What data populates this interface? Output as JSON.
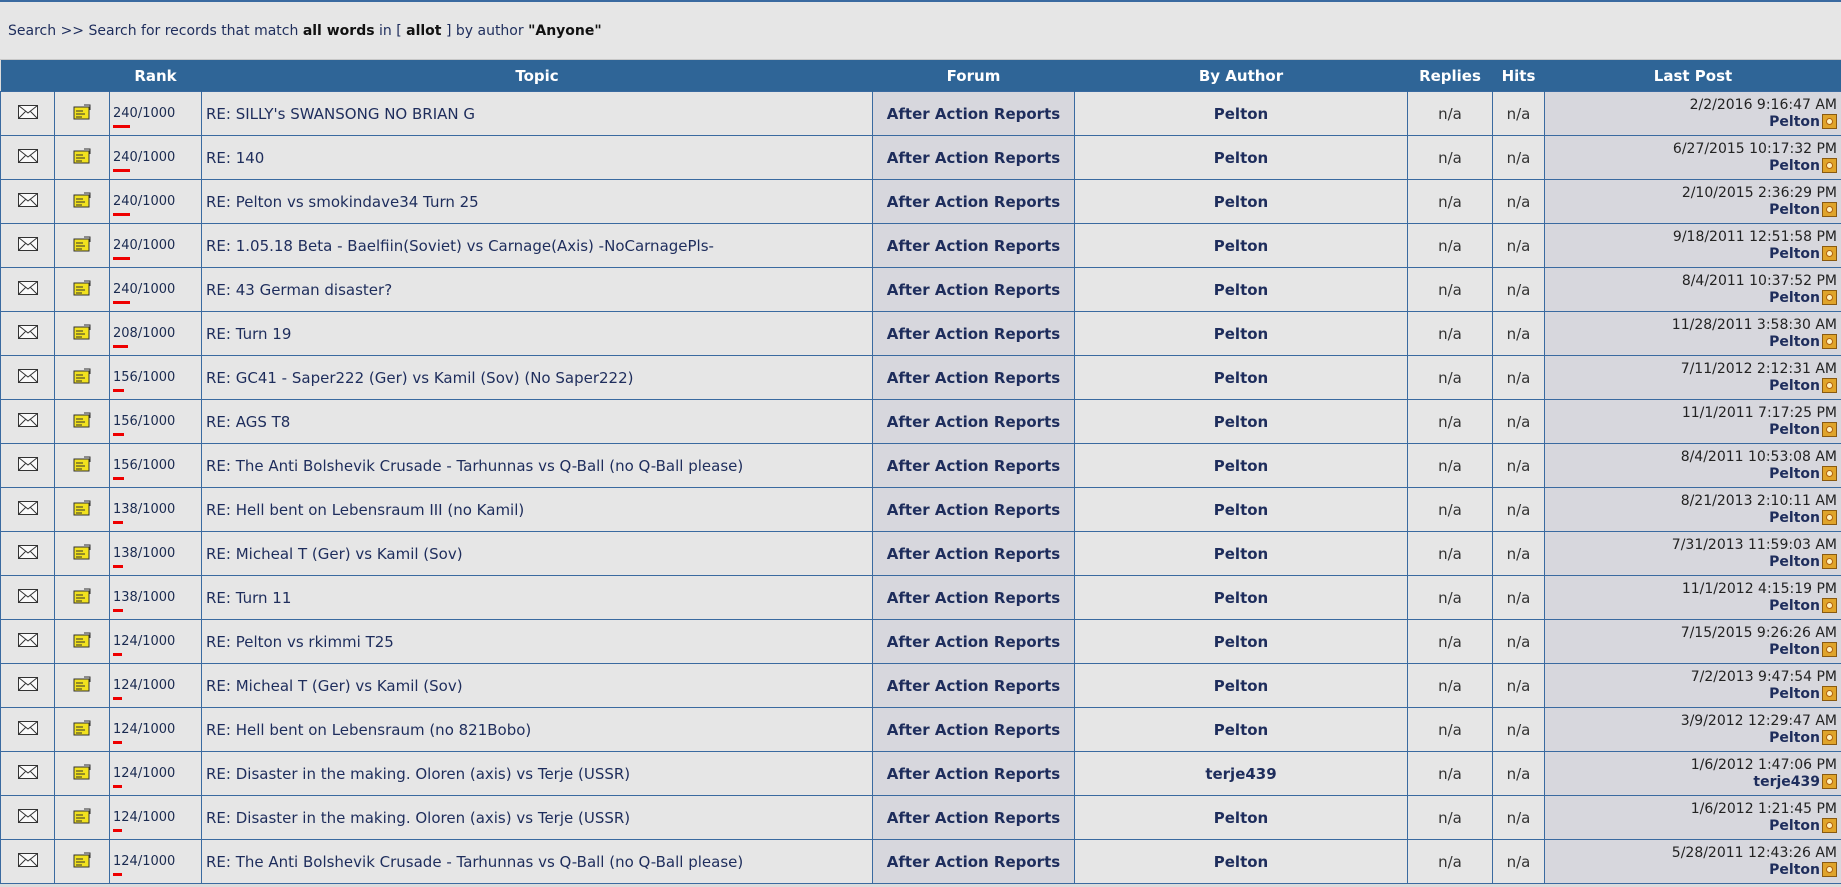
{
  "breadcrumb": {
    "search_link": "Search",
    "separator": ">>",
    "text_before": "Search for records that match",
    "mode": "all words",
    "text_in": "in [",
    "query": "allot",
    "text_by": "] by author",
    "author": "\"Anyone\""
  },
  "colors": {
    "header_bg": "#2f6597",
    "row_bg": "#e6e6e6",
    "rank_bar": "#ee0000",
    "border": "#3a6aa0"
  },
  "columns": {
    "col1": "",
    "col2": "",
    "rank": "Rank",
    "topic": "Topic",
    "forum": "Forum",
    "author": "By Author",
    "replies": "Replies",
    "hits": "Hits",
    "last_post": "Last Post"
  },
  "rows": [
    {
      "rank": "240/1000",
      "score": 240,
      "topic": "RE: SILLY's SWANSONG NO BRIAN G",
      "forum": "After Action Reports",
      "author": "Pelton",
      "replies": "n/a",
      "hits": "n/a",
      "date": "2/2/2016 9:16:47 AM",
      "last_author": "Pelton"
    },
    {
      "rank": "240/1000",
      "score": 240,
      "topic": "RE: 140",
      "forum": "After Action Reports",
      "author": "Pelton",
      "replies": "n/a",
      "hits": "n/a",
      "date": "6/27/2015 10:17:32 PM",
      "last_author": "Pelton"
    },
    {
      "rank": "240/1000",
      "score": 240,
      "topic": "RE: Pelton vs smokindave34 Turn 25",
      "forum": "After Action Reports",
      "author": "Pelton",
      "replies": "n/a",
      "hits": "n/a",
      "date": "2/10/2015 2:36:29 PM",
      "last_author": "Pelton"
    },
    {
      "rank": "240/1000",
      "score": 240,
      "topic": "RE: 1.05.18 Beta - Baelfiin(Soviet) vs Carnage(Axis) -NoCarnagePls-",
      "forum": "After Action Reports",
      "author": "Pelton",
      "replies": "n/a",
      "hits": "n/a",
      "date": "9/18/2011 12:51:58 PM",
      "last_author": "Pelton"
    },
    {
      "rank": "240/1000",
      "score": 240,
      "topic": "RE: 43 German disaster?",
      "forum": "After Action Reports",
      "author": "Pelton",
      "replies": "n/a",
      "hits": "n/a",
      "date": "8/4/2011 10:37:52 PM",
      "last_author": "Pelton"
    },
    {
      "rank": "208/1000",
      "score": 208,
      "topic": "RE: Turn 19",
      "forum": "After Action Reports",
      "author": "Pelton",
      "replies": "n/a",
      "hits": "n/a",
      "date": "11/28/2011 3:58:30 AM",
      "last_author": "Pelton"
    },
    {
      "rank": "156/1000",
      "score": 156,
      "topic": "RE: GC41 - Saper222 (Ger) vs Kamil (Sov) (No Saper222)",
      "forum": "After Action Reports",
      "author": "Pelton",
      "replies": "n/a",
      "hits": "n/a",
      "date": "7/11/2012 2:12:31 AM",
      "last_author": "Pelton"
    },
    {
      "rank": "156/1000",
      "score": 156,
      "topic": "RE: AGS T8",
      "forum": "After Action Reports",
      "author": "Pelton",
      "replies": "n/a",
      "hits": "n/a",
      "date": "11/1/2011 7:17:25 PM",
      "last_author": "Pelton"
    },
    {
      "rank": "156/1000",
      "score": 156,
      "topic": "RE: The Anti Bolshevik Crusade - Tarhunnas vs Q-Ball (no Q-Ball please)",
      "forum": "After Action Reports",
      "author": "Pelton",
      "replies": "n/a",
      "hits": "n/a",
      "date": "8/4/2011 10:53:08 AM",
      "last_author": "Pelton"
    },
    {
      "rank": "138/1000",
      "score": 138,
      "topic": "RE: Hell bent on Lebensraum III (no Kamil)",
      "forum": "After Action Reports",
      "author": "Pelton",
      "replies": "n/a",
      "hits": "n/a",
      "date": "8/21/2013 2:10:11 AM",
      "last_author": "Pelton"
    },
    {
      "rank": "138/1000",
      "score": 138,
      "topic": "RE: Micheal T (Ger) vs Kamil (Sov)",
      "forum": "After Action Reports",
      "author": "Pelton",
      "replies": "n/a",
      "hits": "n/a",
      "date": "7/31/2013 11:59:03 AM",
      "last_author": "Pelton"
    },
    {
      "rank": "138/1000",
      "score": 138,
      "topic": "RE: Turn 11",
      "forum": "After Action Reports",
      "author": "Pelton",
      "replies": "n/a",
      "hits": "n/a",
      "date": "11/1/2012 4:15:19 PM",
      "last_author": "Pelton"
    },
    {
      "rank": "124/1000",
      "score": 124,
      "topic": "RE: Pelton vs rkimmi T25",
      "forum": "After Action Reports",
      "author": "Pelton",
      "replies": "n/a",
      "hits": "n/a",
      "date": "7/15/2015 9:26:26 AM",
      "last_author": "Pelton"
    },
    {
      "rank": "124/1000",
      "score": 124,
      "topic": "RE: Micheal T (Ger) vs Kamil (Sov)",
      "forum": "After Action Reports",
      "author": "Pelton",
      "replies": "n/a",
      "hits": "n/a",
      "date": "7/2/2013 9:47:54 PM",
      "last_author": "Pelton"
    },
    {
      "rank": "124/1000",
      "score": 124,
      "topic": "RE: Hell bent on Lebensraum (no 821Bobo)",
      "forum": "After Action Reports",
      "author": "Pelton",
      "replies": "n/a",
      "hits": "n/a",
      "date": "3/9/2012 12:29:47 AM",
      "last_author": "Pelton"
    },
    {
      "rank": "124/1000",
      "score": 124,
      "topic": "RE: Disaster in the making. Oloren (axis) vs Terje (USSR)",
      "forum": "After Action Reports",
      "author": "terje439",
      "replies": "n/a",
      "hits": "n/a",
      "date": "1/6/2012 1:47:06 PM",
      "last_author": "terje439"
    },
    {
      "rank": "124/1000",
      "score": 124,
      "topic": "RE: Disaster in the making. Oloren (axis) vs Terje (USSR)",
      "forum": "After Action Reports",
      "author": "Pelton",
      "replies": "n/a",
      "hits": "n/a",
      "date": "1/6/2012 1:21:45 PM",
      "last_author": "Pelton"
    },
    {
      "rank": "124/1000",
      "score": 124,
      "topic": "RE: The Anti Bolshevik Crusade - Tarhunnas vs Q-Ball (no Q-Ball please)",
      "forum": "After Action Reports",
      "author": "Pelton",
      "replies": "n/a",
      "hits": "n/a",
      "date": "5/28/2011 12:43:26 AM",
      "last_author": "Pelton"
    }
  ],
  "icons": {
    "message": "envelope-icon",
    "thread": "thread-icon",
    "jump": "jump-to-post-icon"
  }
}
